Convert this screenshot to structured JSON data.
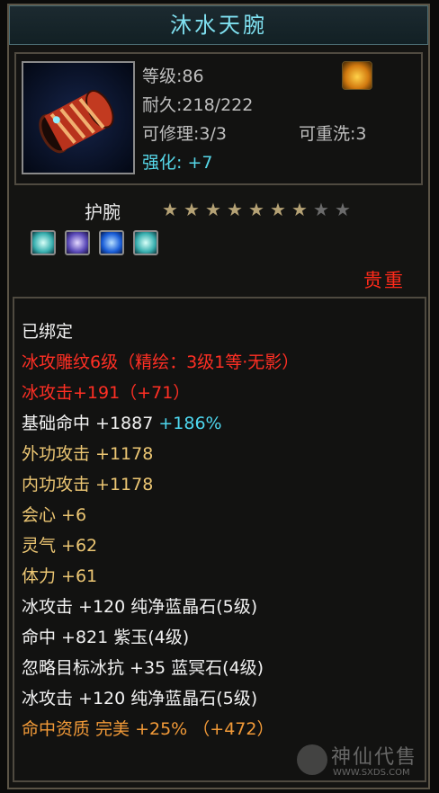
{
  "item": {
    "name": "沐水天腕",
    "icon": "bracer-icon",
    "level": "等级:86",
    "durability": "耐久:218/222",
    "repairable": "可修理:3/3",
    "rewashable": "可重洗:3",
    "enhance": "强化: +7",
    "category": "护腕",
    "stars_filled": 7,
    "stars_total": 9,
    "rarity": "贵重"
  },
  "gems": [
    "cyan-gem-icon",
    "purple-gem-icon",
    "blue-gem-icon",
    "cyan-gem-icon"
  ],
  "attributes": [
    {
      "text": "已绑定",
      "color": "white"
    },
    {
      "text": "冰攻雕纹6级（精绘：3级1等·无影）",
      "color": "red"
    },
    {
      "text": "冰攻击+191（+71）",
      "color": "red"
    },
    {
      "text": "基础命中 +1887",
      "extra": "+186%",
      "color": "white"
    },
    {
      "text": "外功攻击 +1178",
      "color": "gold"
    },
    {
      "text": "内功攻击 +1178",
      "color": "gold"
    },
    {
      "text": "会心 +6",
      "color": "gold"
    },
    {
      "text": "灵气 +62",
      "color": "gold"
    },
    {
      "text": "体力 +61",
      "color": "gold"
    },
    {
      "text": "冰攻击 +120 纯净蓝晶石(5级)",
      "color": "white"
    },
    {
      "text": "命中 +821 紫玉(4级)",
      "color": "white"
    },
    {
      "text": "忽略目标冰抗 +35 蓝冥石(4级)",
      "color": "white"
    },
    {
      "text": "冰攻击 +120 纯净蓝晶石(5级)",
      "color": "white"
    },
    {
      "text": "命中资质  完美 +25% （+472）",
      "color": "orange"
    }
  ],
  "watermark": {
    "text": "神仙代售",
    "url": "WWW.SXDS.COM"
  },
  "colors": {
    "title": "#7fe0f0",
    "red": "#ff2f24",
    "gold": "#ecc673",
    "cyan": "#4ed8f0",
    "orange": "#f29a38"
  }
}
